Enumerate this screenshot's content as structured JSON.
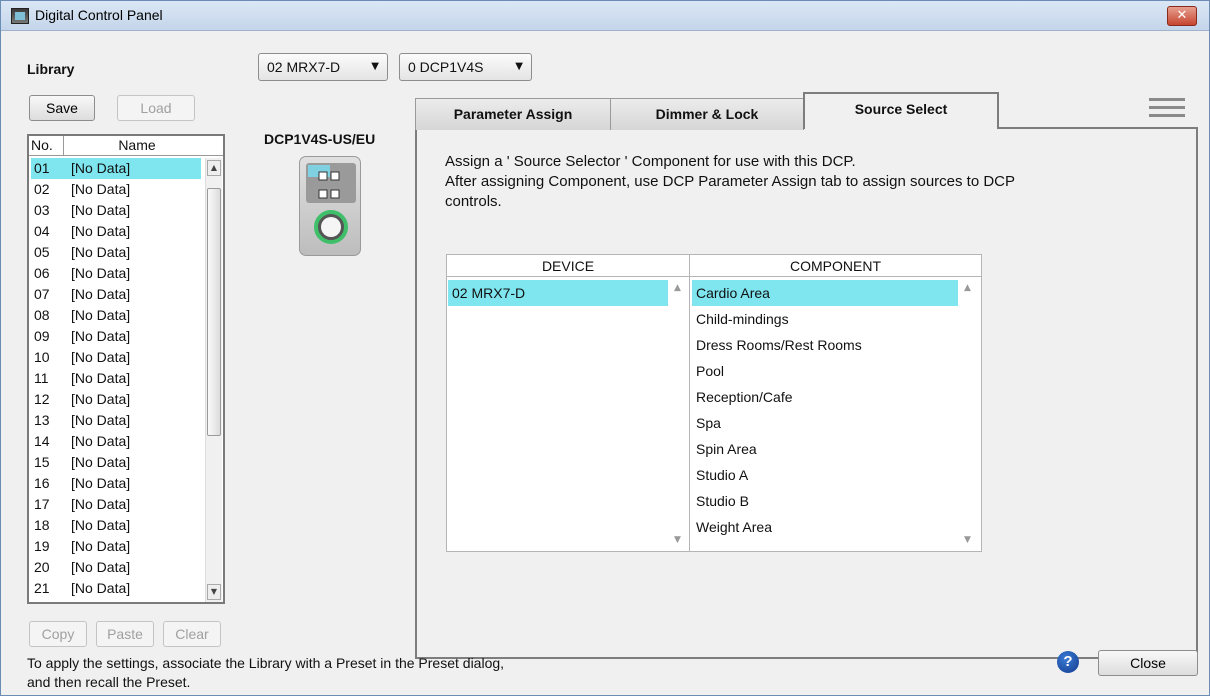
{
  "window": {
    "title": "Digital Control Panel",
    "close_glyph": "✕"
  },
  "library": {
    "label": "Library",
    "save_label": "Save",
    "load_label": "Load",
    "columns": [
      "No.",
      "Name"
    ],
    "rows": [
      {
        "no": "01",
        "name": "[No Data]"
      },
      {
        "no": "02",
        "name": "[No Data]"
      },
      {
        "no": "03",
        "name": "[No Data]"
      },
      {
        "no": "04",
        "name": "[No Data]"
      },
      {
        "no": "05",
        "name": "[No Data]"
      },
      {
        "no": "06",
        "name": "[No Data]"
      },
      {
        "no": "07",
        "name": "[No Data]"
      },
      {
        "no": "08",
        "name": "[No Data]"
      },
      {
        "no": "09",
        "name": "[No Data]"
      },
      {
        "no": "10",
        "name": "[No Data]"
      },
      {
        "no": "11",
        "name": "[No Data]"
      },
      {
        "no": "12",
        "name": "[No Data]"
      },
      {
        "no": "13",
        "name": "[No Data]"
      },
      {
        "no": "14",
        "name": "[No Data]"
      },
      {
        "no": "15",
        "name": "[No Data]"
      },
      {
        "no": "16",
        "name": "[No Data]"
      },
      {
        "no": "17",
        "name": "[No Data]"
      },
      {
        "no": "18",
        "name": "[No Data]"
      },
      {
        "no": "19",
        "name": "[No Data]"
      },
      {
        "no": "20",
        "name": "[No Data]"
      },
      {
        "no": "21",
        "name": "[No Data]"
      }
    ],
    "copy_label": "Copy",
    "paste_label": "Paste",
    "clear_label": "Clear"
  },
  "selectors": {
    "device": "02 MRX7-D",
    "dcp": "0 DCP1V4S"
  },
  "dcp_model": "DCP1V4S-US/EU",
  "tabs": [
    {
      "label": "Parameter Assign",
      "active": false
    },
    {
      "label": "Dimmer & Lock",
      "active": false
    },
    {
      "label": "Source Select",
      "active": true
    }
  ],
  "source_select": {
    "line1": "Assign a ' Source Selector ' Component for use with this DCP.",
    "line2": "After assigning Component, use DCP Parameter Assign tab to assign sources to DCP",
    "line3": "controls.",
    "device_header": "DEVICE",
    "component_header": "COMPONENT",
    "devices": [
      "02 MRX7-D"
    ],
    "components": [
      "Cardio Area",
      "Child-mindings",
      "Dress Rooms/Rest Rooms",
      "Pool",
      "Reception/Cafe",
      "Spa",
      "Spin Area",
      "Studio A",
      "Studio B",
      "Weight Area"
    ]
  },
  "footer": {
    "hint_line1": "To apply the settings, associate the Library with a Preset in the Preset dialog,",
    "hint_line2": "and then recall the Preset.",
    "help_glyph": "?",
    "close_label": "Close"
  },
  "colors": {
    "selection": "#7fe6f0",
    "title_bar": "#c4d5ea"
  }
}
